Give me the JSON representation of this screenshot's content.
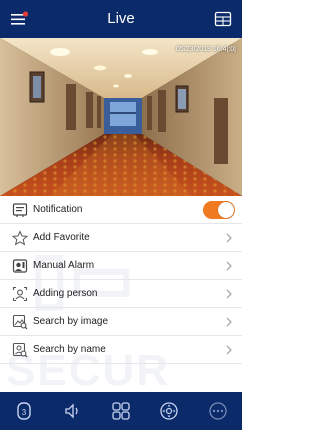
{
  "header": {
    "title": "Live",
    "menu_icon": "menu-icon",
    "grid_icon": "window-grid-icon"
  },
  "video": {
    "timestamp": "05/23/2018 16:4|:0|",
    "scene": "hotel corridor with patterned carpet"
  },
  "menu": {
    "items": [
      {
        "label": "Notification",
        "icon": "notification-icon",
        "control": "toggle",
        "toggle_on": true
      },
      {
        "label": "Add Favorite",
        "icon": "star-icon",
        "control": "chevron"
      },
      {
        "label": "Manual Alarm",
        "icon": "alarm-icon",
        "control": "chevron"
      },
      {
        "label": "Adding person",
        "icon": "add-person-icon",
        "control": "chevron"
      },
      {
        "label": "Search by image",
        "icon": "image-search-icon",
        "control": "chevron"
      },
      {
        "label": "Search by name",
        "icon": "name-search-icon",
        "control": "chevron"
      }
    ]
  },
  "bottombar": {
    "items": [
      {
        "icon": "record-icon"
      },
      {
        "icon": "volume-icon"
      },
      {
        "icon": "layout-grid-icon"
      },
      {
        "icon": "ptz-icon"
      },
      {
        "icon": "more-icon"
      }
    ]
  },
  "colors": {
    "bar": "#0a2a6a",
    "toggle": "#f07a22",
    "icon": "#c8d4f0"
  }
}
